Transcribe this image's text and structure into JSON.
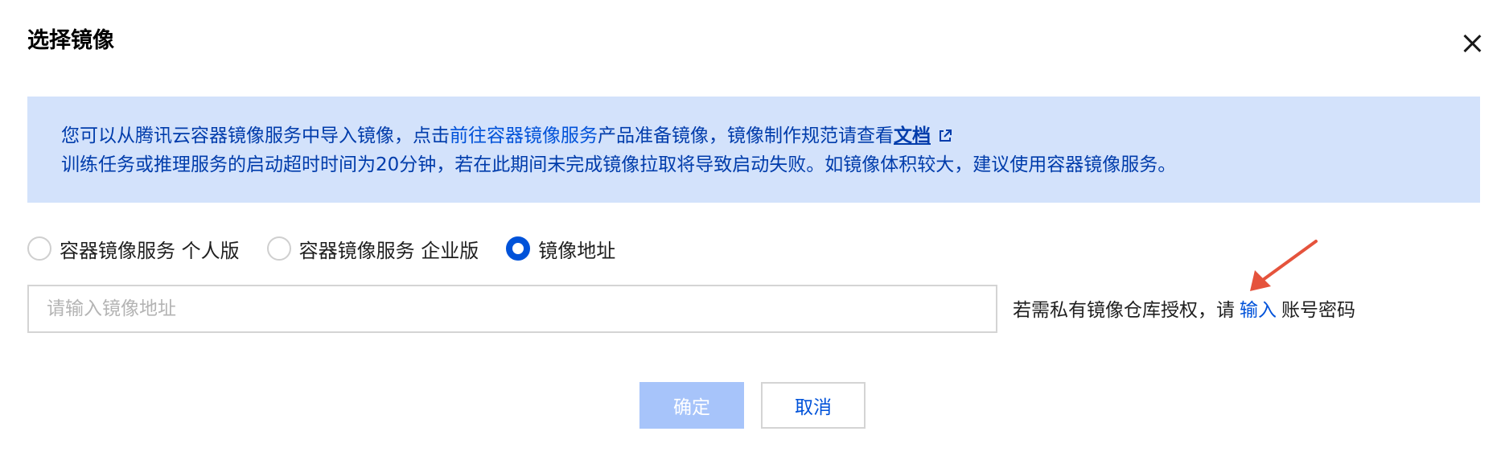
{
  "dialog": {
    "title": "选择镜像"
  },
  "notice": {
    "line1_prefix": "您可以从腾讯云容器镜像服务中导入镜像，点击",
    "line1_link": "前往容器镜像服务",
    "line1_middle": "产品准备镜像，镜像制作规范请查看",
    "line1_doc_link": "文档",
    "line2": "训练任务或推理服务的启动超时时间为20分钟，若在此期间未完成镜像拉取将导致启动失败。如镜像体积较大，建议使用容器镜像服务。"
  },
  "image_source": {
    "options": [
      {
        "label": "容器镜像服务 个人版",
        "checked": false
      },
      {
        "label": "容器镜像服务 企业版",
        "checked": false
      },
      {
        "label": "镜像地址",
        "checked": true
      }
    ]
  },
  "image_address": {
    "value": "",
    "placeholder": "请输入镜像地址"
  },
  "auth_hint": {
    "prefix": "若需私有镜像仓库授权，请",
    "link": "输入",
    "suffix": "账号密码"
  },
  "footer": {
    "confirm_label": "确定",
    "cancel_label": "取消"
  },
  "icons": {
    "close": "close-icon",
    "external_link": "external-link-icon",
    "annotation": "red-arrow-annotation"
  },
  "colors": {
    "primary": "#0052d9",
    "notice_background": "#d3e2fb",
    "notice_text": "#003cab",
    "confirm_disabled": "#a7c4fa",
    "annotation_arrow": "#e5533c"
  }
}
